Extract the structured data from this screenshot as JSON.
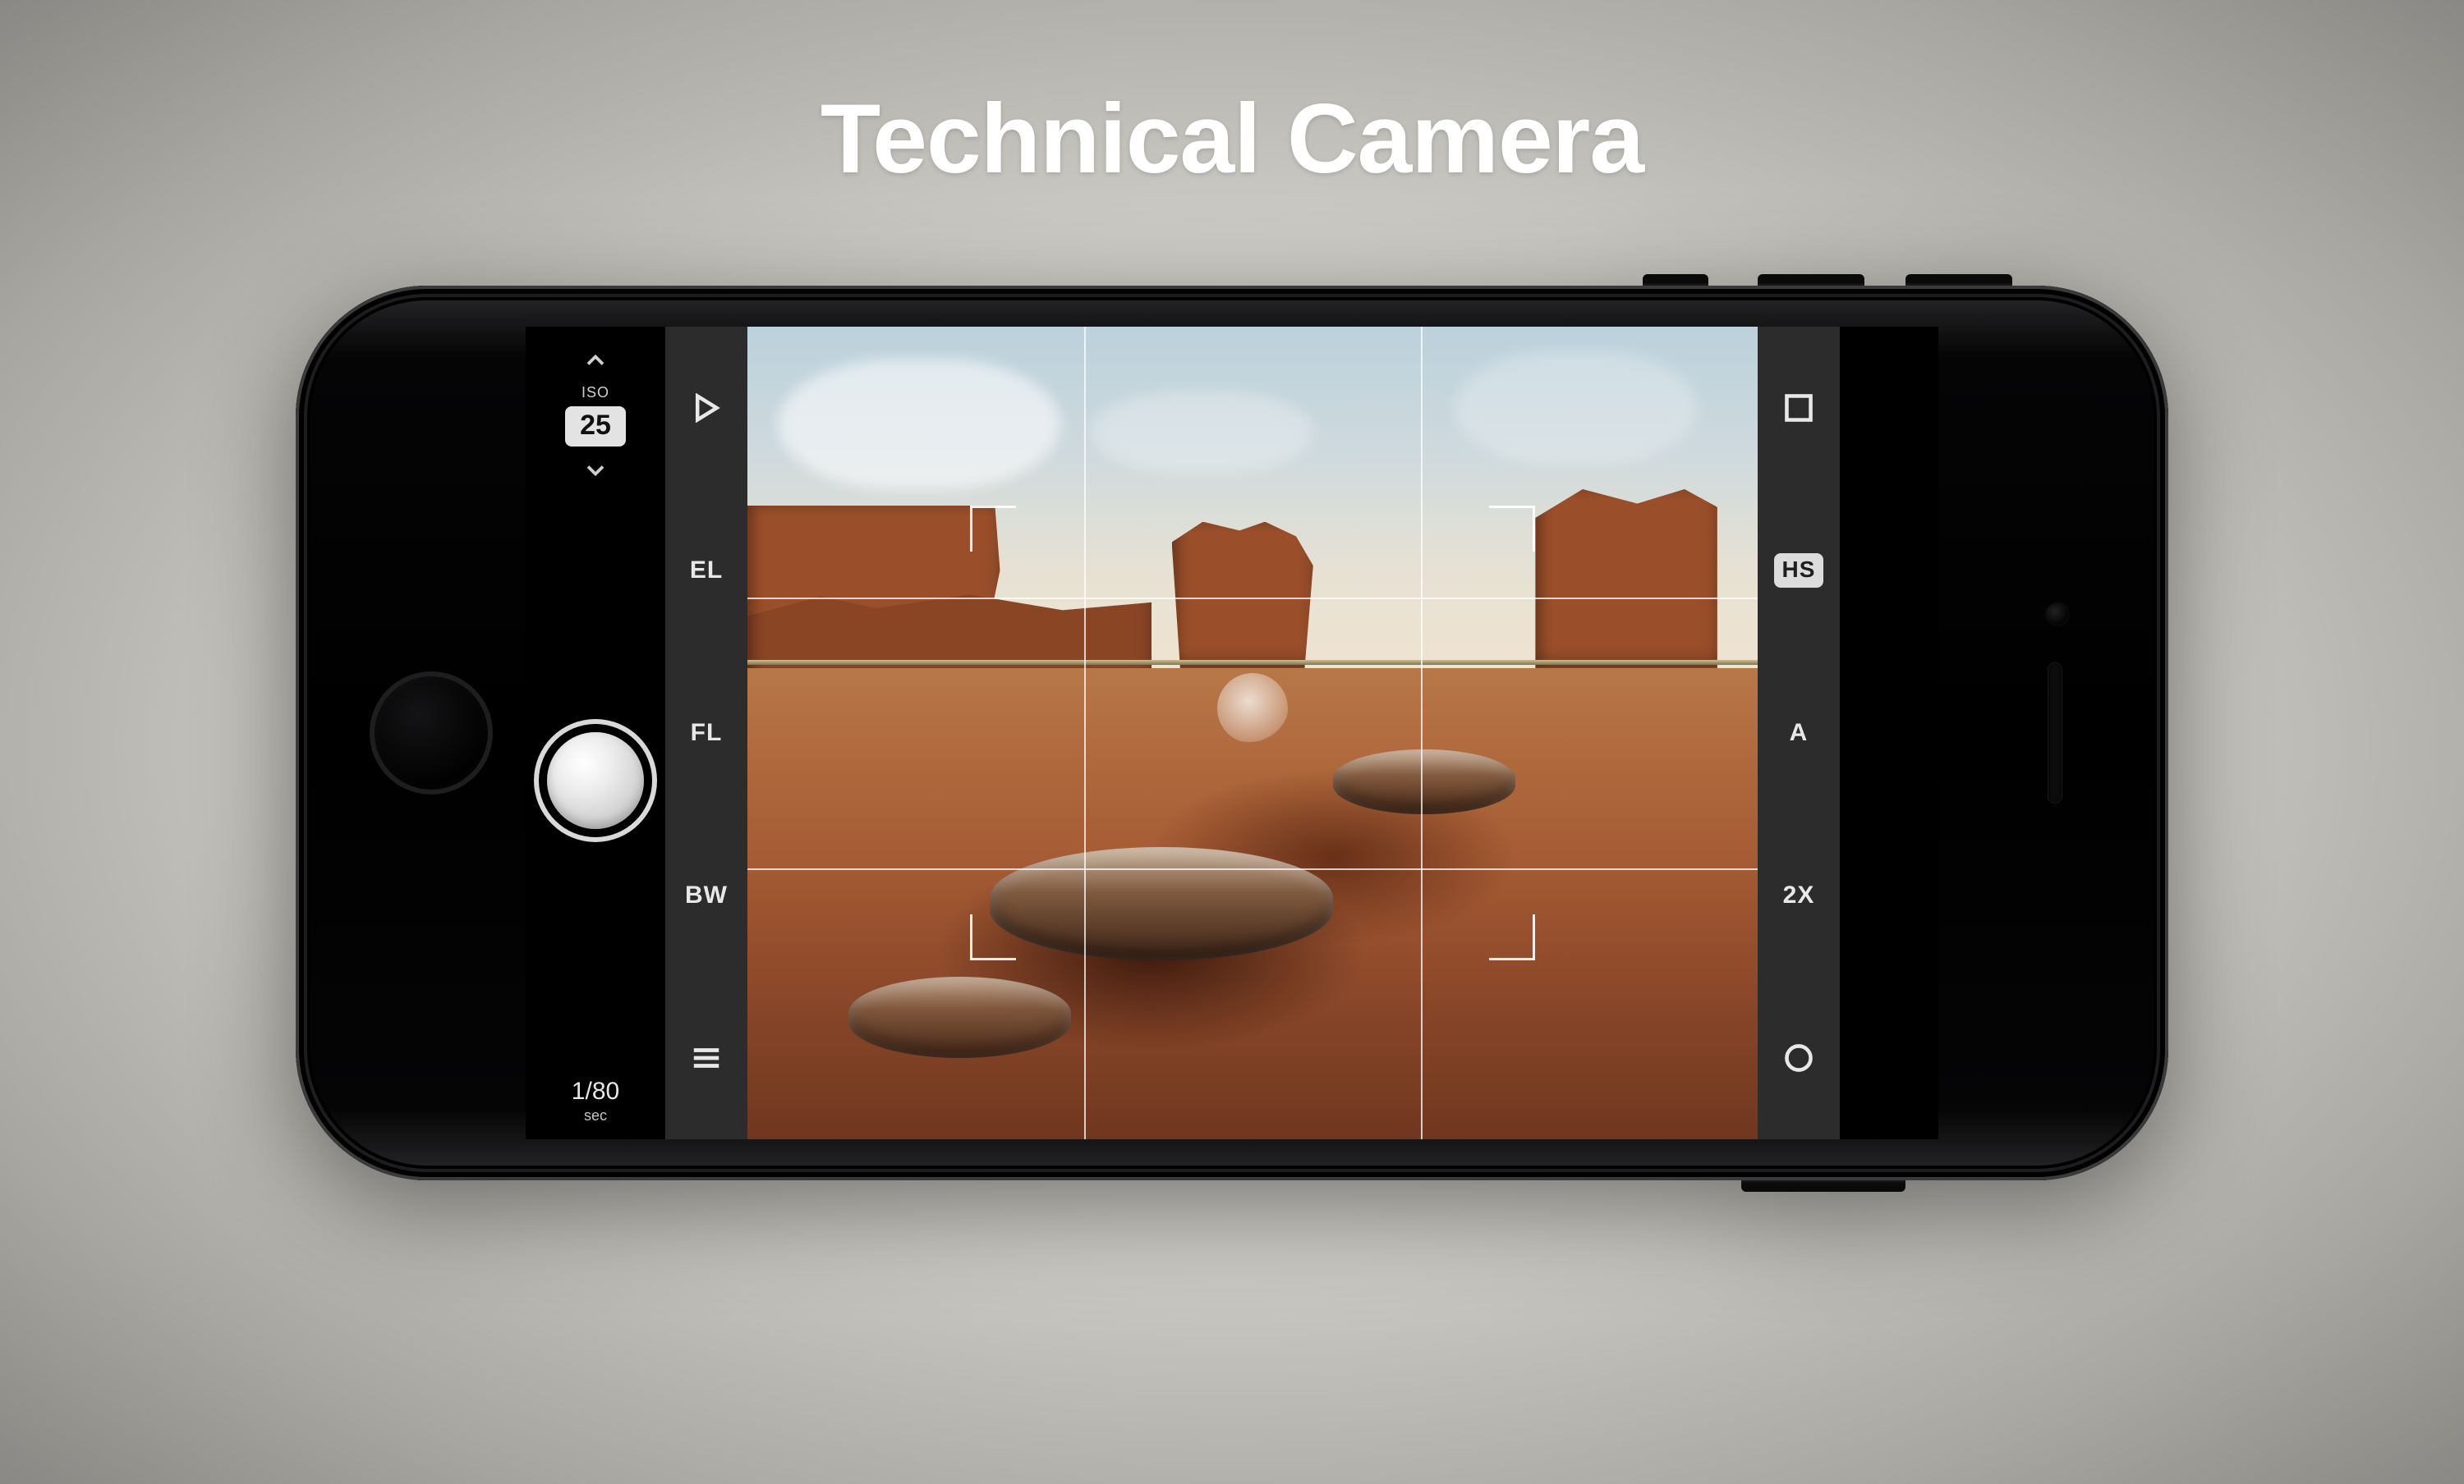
{
  "title": "Technical Camera",
  "controls": {
    "iso_label": "ISO",
    "iso_value": "25",
    "shutter_speed": "1/80",
    "shutter_unit": "sec"
  },
  "left_tools": {
    "play": "play-icon",
    "exposure_lock": "EL",
    "focus_lock": "FL",
    "bw": "BW",
    "menu": "menu-icon"
  },
  "right_tools": {
    "format": "square-icon",
    "mode_badge": "HS",
    "auto": "A",
    "zoom": "2X",
    "record": "record-icon"
  },
  "icons": {
    "chev_up": "chevron-up-icon",
    "chev_down": "chevron-down-icon"
  }
}
